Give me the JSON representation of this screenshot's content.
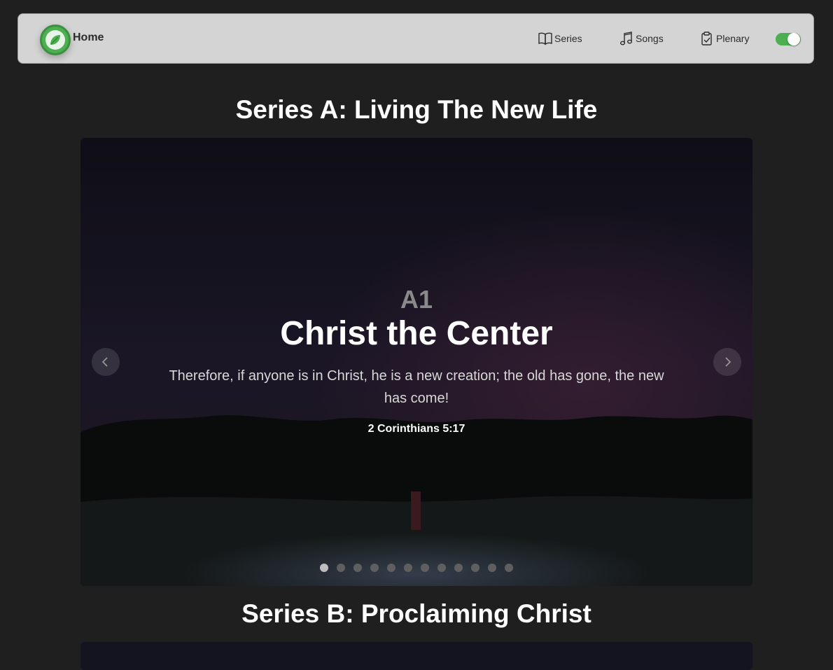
{
  "nav": {
    "home_label": "Home",
    "items": [
      {
        "label": "Series",
        "icon": "book-open-icon"
      },
      {
        "label": "Songs",
        "icon": "music-note-icon"
      },
      {
        "label": "Plenary",
        "icon": "clipboard-check-icon"
      }
    ],
    "theme_toggle_on": true
  },
  "sections": [
    {
      "title": "Series A: Living The New Life",
      "slide": {
        "code": "A1",
        "title": "Christ the Center",
        "verse": "Therefore, if anyone is in Christ, he is a new creation; the old has gone, the new has come!",
        "reference": "2 Corinthians 5:17"
      },
      "slide_count": 12,
      "active_slide_index": 0
    },
    {
      "title": "Series B: Proclaiming Christ"
    }
  ],
  "colors": {
    "accent": "#4caf50",
    "navbar_bg": "#d4d4d4",
    "page_bg": "#1f1f1f"
  }
}
